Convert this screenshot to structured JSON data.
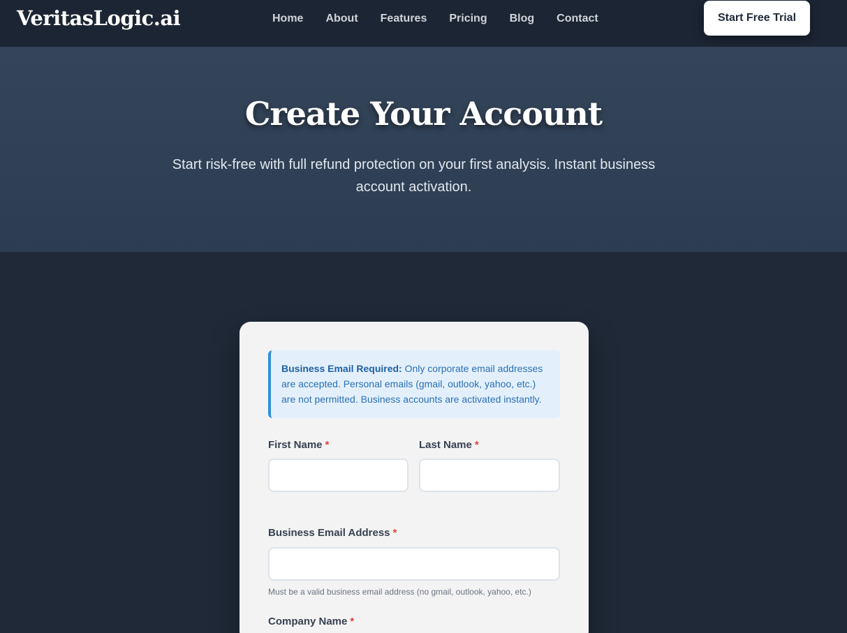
{
  "nav": {
    "logo": "VeritasLogic.ai",
    "links": [
      "Home",
      "About",
      "Features",
      "Pricing",
      "Blog",
      "Contact"
    ],
    "cta": "Start Free Trial"
  },
  "hero": {
    "title": "Create Your Account",
    "subtitle": "Start risk-free with full refund protection on your first analysis. Instant business account activation."
  },
  "form": {
    "notice": {
      "heading": "Business Email Required:",
      "text": "Only corporate email addresses are accepted. Personal emails (gmail, outlook, yahoo, etc.) are not permitted. Business accounts are activated instantly."
    },
    "required_mark": "*",
    "first_name": {
      "label": "First Name",
      "value": ""
    },
    "last_name": {
      "label": "Last Name",
      "value": ""
    },
    "email": {
      "label": "Business Email Address",
      "value": "",
      "hint": "Must be a valid business email address (no gmail, outlook, yahoo, etc.)"
    },
    "company": {
      "label": "Company Name"
    }
  },
  "colors": {
    "accent": "#2f8fd8",
    "required": "#e53e3e",
    "background": "#1f2937"
  }
}
